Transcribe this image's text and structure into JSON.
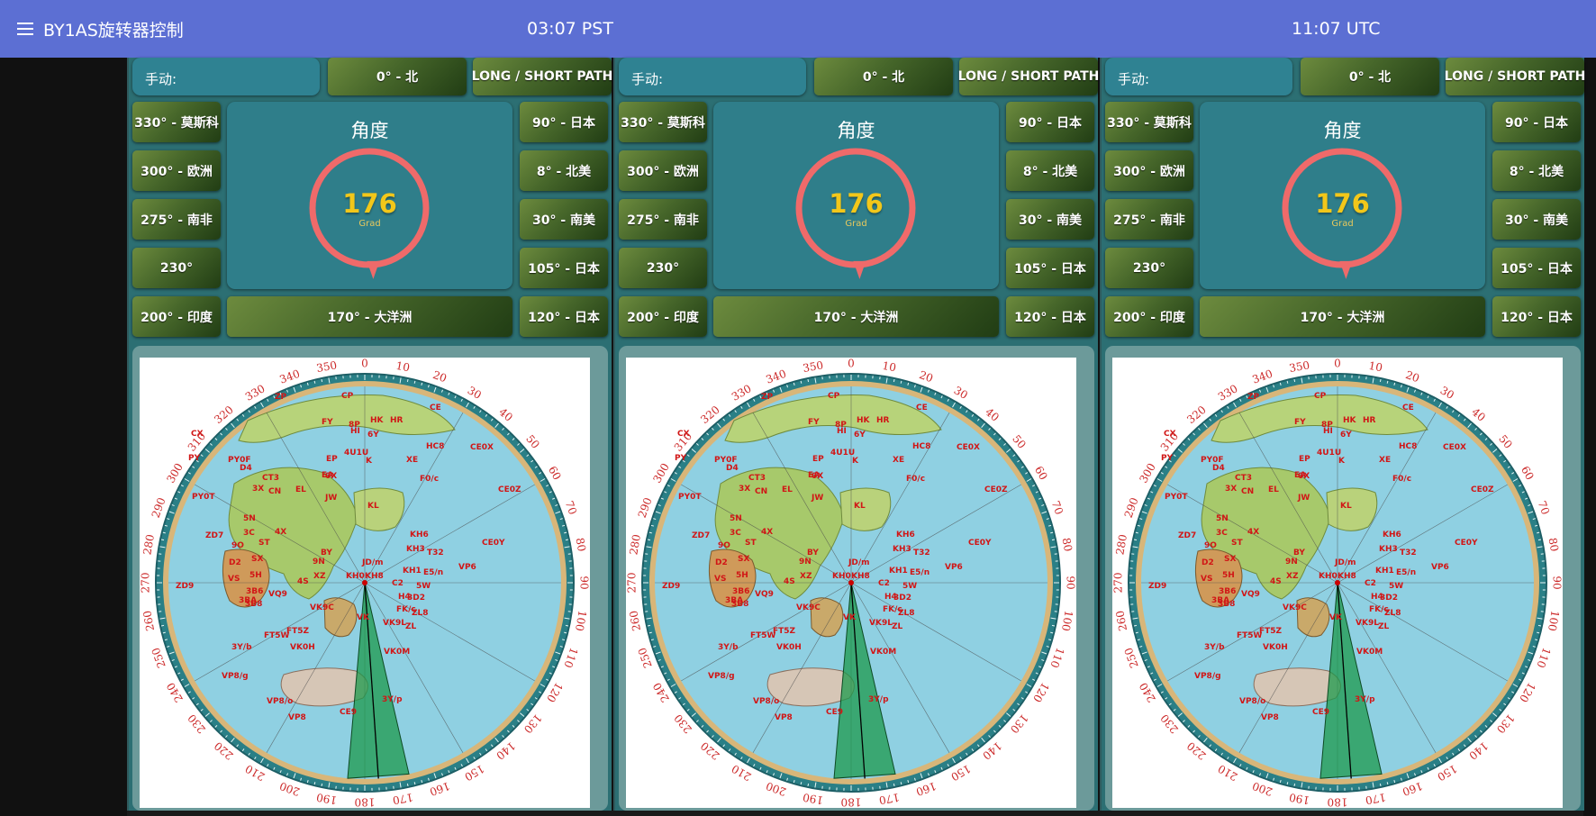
{
  "header": {
    "title": "BY1AS旋转器控制",
    "time_pst": "03:07 PST",
    "time_utc": "11:07 UTC"
  },
  "controls": {
    "manual_label": "手动:",
    "north": "0° - 北",
    "long_short": "LONG / SHORT PATH",
    "left_buttons": [
      "330° - 莫斯科",
      "300° - 欧洲",
      "275° - 南非",
      "230°",
      "200° - 印度"
    ],
    "right_buttons": [
      "90° - 日本",
      "8° - 北美",
      "30° - 南美",
      "105° - 日本",
      "120° - 日本"
    ],
    "bottom_center": "170° - 大洋洲"
  },
  "dial": {
    "title": "角度",
    "value": "176",
    "unit": "Grad",
    "heading_deg": 176
  },
  "map": {
    "bearing_labels": [
      "0",
      "10",
      "20",
      "30",
      "40",
      "50",
      "60",
      "70",
      "80",
      "90",
      "100",
      "110",
      "120",
      "130",
      "140",
      "150",
      "160",
      "170",
      "180",
      "190",
      "200",
      "210",
      "220",
      "230",
      "240",
      "250",
      "260",
      "270",
      "280",
      "290",
      "300",
      "310",
      "320",
      "330",
      "340",
      "350"
    ],
    "callsigns": [
      "CP",
      "ZP",
      "CE",
      "HK",
      "HR",
      "FY",
      "8P",
      "HI",
      "6Y",
      "HC8",
      "4U1U",
      "K",
      "CE0X",
      "EP",
      "XE",
      "F0/c",
      "CX",
      "PY",
      "PY0F",
      "D4",
      "CT3",
      "3X",
      "CN",
      "EL",
      "EA",
      "0X",
      "JW",
      "CE0Z",
      "PY0T",
      "5N",
      "ZD7",
      "KL",
      "KH6",
      "3C",
      "4X",
      "KH3",
      "T32",
      "CE0Y",
      "ZD9",
      "SX",
      "9O",
      "ST",
      "BY",
      "JD/m",
      "VP6",
      "D2",
      "9N",
      "KH1",
      "E5/n",
      "VS",
      "5H",
      "XZ",
      "KH8",
      "KH0",
      "C2",
      "5W",
      "3B6",
      "VQ9",
      "4S",
      "H4",
      "3D2",
      "3BA",
      "3B8",
      "VK9C",
      "FK/c",
      "ZL8",
      "VK9L",
      "ZL",
      "FT5W",
      "FT5Z",
      "VK0H",
      "VK0M",
      "3Y/b",
      "VP8/g",
      "VP8/o",
      "VP8",
      "3Y/p",
      "CE9",
      "VK"
    ]
  },
  "colors": {
    "topbar": "#5c6fd3",
    "panel": "#2c6f73",
    "dial_ring": "#ef6a6a",
    "dial_value": "#f2c71a",
    "beam": "#1e9a4c"
  }
}
